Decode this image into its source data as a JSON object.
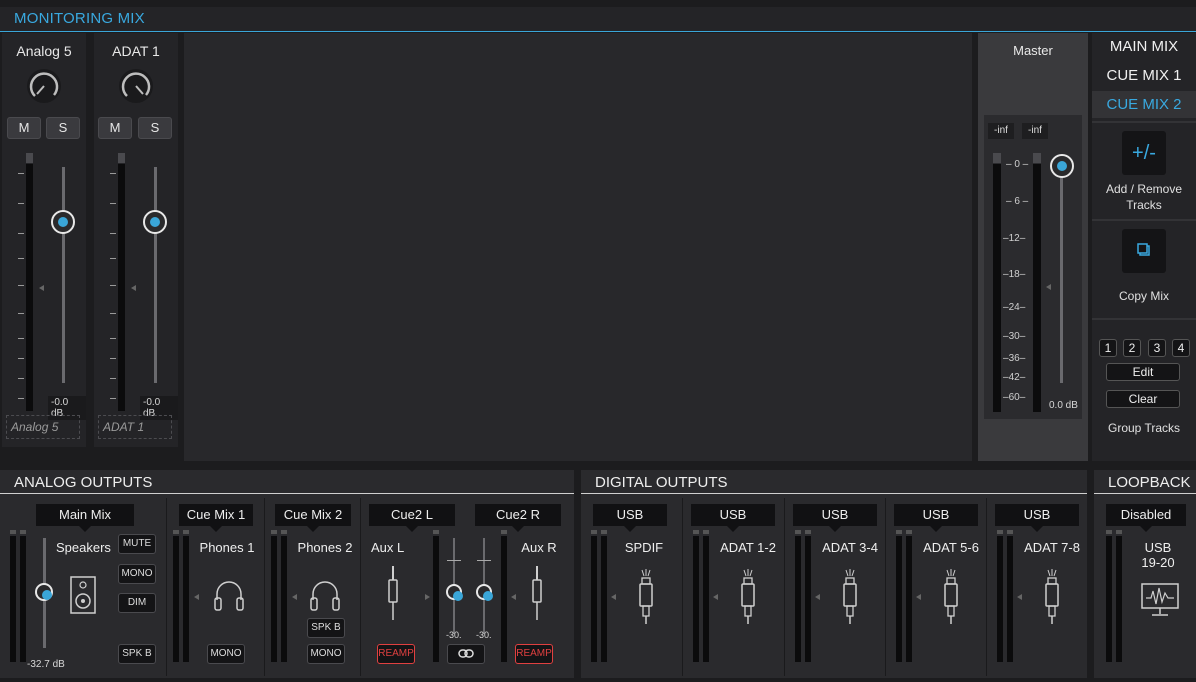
{
  "header": {
    "title": "MONITORING MIX"
  },
  "channels": [
    {
      "name": "Analog 5",
      "mute": "M",
      "solo": "S",
      "db": "-0.0 dB",
      "label": "Analog 5"
    },
    {
      "name": "ADAT 1",
      "mute": "M",
      "solo": "S",
      "db": "-0.0 dB",
      "label": "ADAT 1"
    }
  ],
  "master": {
    "title": "Master",
    "inf_l": "-inf",
    "inf_r": "-inf",
    "scale": [
      "0",
      "6",
      "12",
      "18",
      "24",
      "30",
      "36",
      "42",
      "60"
    ],
    "db": "0.0 dB"
  },
  "mixes": {
    "items": [
      "MAIN MIX",
      "CUE MIX 1",
      "CUE MIX 2"
    ],
    "active": "CUE MIX 2"
  },
  "tools": {
    "add_remove_glyph": "+/-",
    "add_remove_label": "Add / Remove Tracks",
    "copy_mix_label": "Copy Mix",
    "groups": [
      "1",
      "2",
      "3",
      "4"
    ],
    "edit_label": "Edit",
    "clear_label": "Clear",
    "group_tracks_label": "Group Tracks"
  },
  "analog_outputs": {
    "title": "ANALOG OUTPUTS",
    "main": {
      "source": "Main Mix",
      "name": "Speakers",
      "mute": "MUTE",
      "mono": "MONO",
      "dim": "DIM",
      "spk_b": "SPK B",
      "db": "-32.7 dB"
    },
    "cue1": {
      "source": "Cue Mix 1",
      "name": "Phones 1",
      "mono": "MONO"
    },
    "cue2": {
      "source": "Cue Mix 2",
      "name": "Phones 2",
      "spk_b": "SPK B",
      "mono": "MONO"
    },
    "aux_l": {
      "source": "Cue2 L",
      "name": "Aux L",
      "reamp": "REAMP",
      "trim": "-30."
    },
    "aux_r": {
      "source": "Cue2 R",
      "name": "Aux R",
      "reamp": "REAMP",
      "trim": "-30."
    }
  },
  "digital_outputs": {
    "title": "DIGITAL OUTPUTS",
    "items": [
      {
        "source": "USB",
        "name": "SPDIF"
      },
      {
        "source": "USB",
        "name": "ADAT 1-2"
      },
      {
        "source": "USB",
        "name": "ADAT 3-4"
      },
      {
        "source": "USB",
        "name": "ADAT 5-6"
      },
      {
        "source": "USB",
        "name": "ADAT 7-8"
      }
    ]
  },
  "loopback": {
    "title": "LOOPBACK",
    "source": "Disabled",
    "name_line1": "USB",
    "name_line2": "19-20"
  },
  "colors": {
    "accent": "#39a9e0",
    "reamp": "#e04040"
  }
}
